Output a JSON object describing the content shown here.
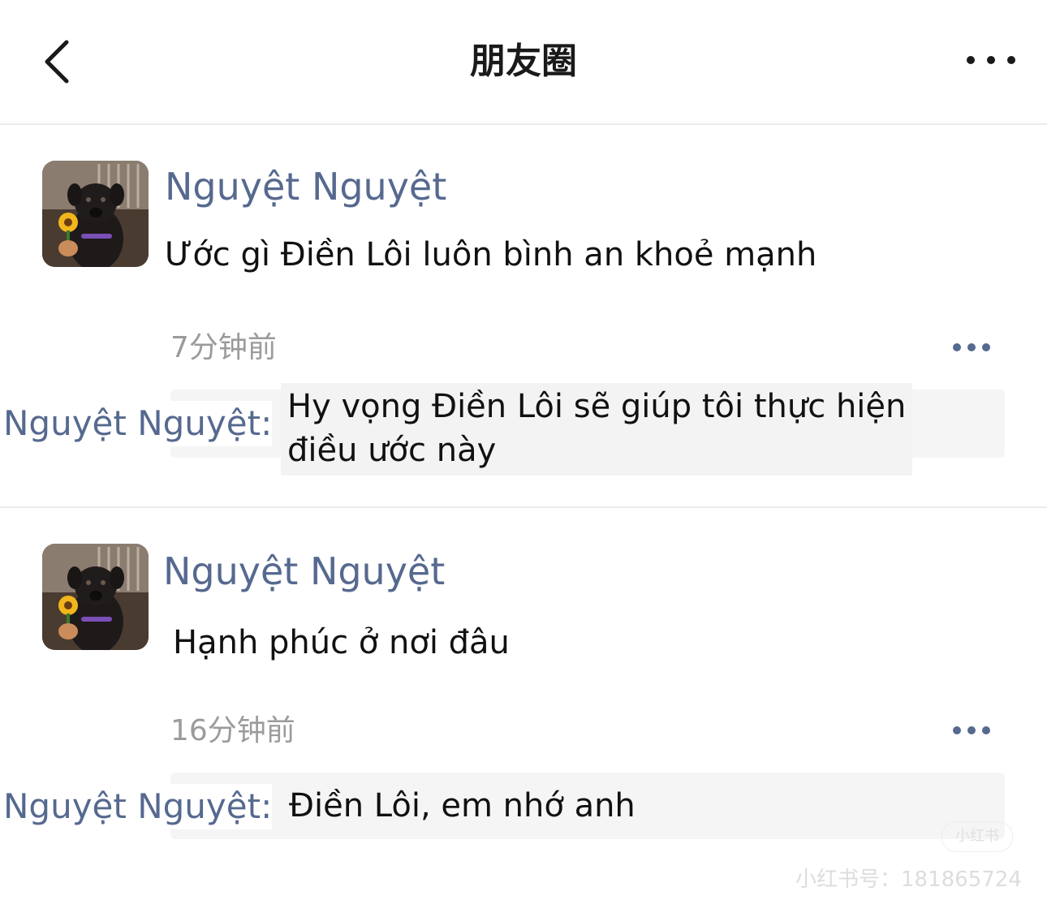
{
  "navbar": {
    "title": "朋友圈",
    "back_icon": "chevron-left-icon",
    "more_icon": "more-horizontal-icon"
  },
  "posts": [
    {
      "username": "Nguyệt Nguyệt",
      "text": "Ước gì Điền Lôi luôn bình an khoẻ mạnh",
      "timestamp": "7分钟前",
      "comment": {
        "author": "Nguyệt Nguyệt:",
        "text": "Hy vọng Điền Lôi sẽ giúp tôi thực hiện điều ước này"
      }
    },
    {
      "username": "Nguyệt Nguyệt",
      "text": "Hạnh phúc ở nơi đâu",
      "timestamp": "16分钟前",
      "comment": {
        "author": "Nguyệt Nguyệt:",
        "text": "Điền Lôi, em nhớ anh"
      }
    }
  ],
  "watermark": {
    "badge": "小红书",
    "id": "小红书号：181865724"
  },
  "colors": {
    "name_blue": "#56698f",
    "time_gray": "#9b9b9b",
    "comment_bg": "#f5f5f5"
  }
}
